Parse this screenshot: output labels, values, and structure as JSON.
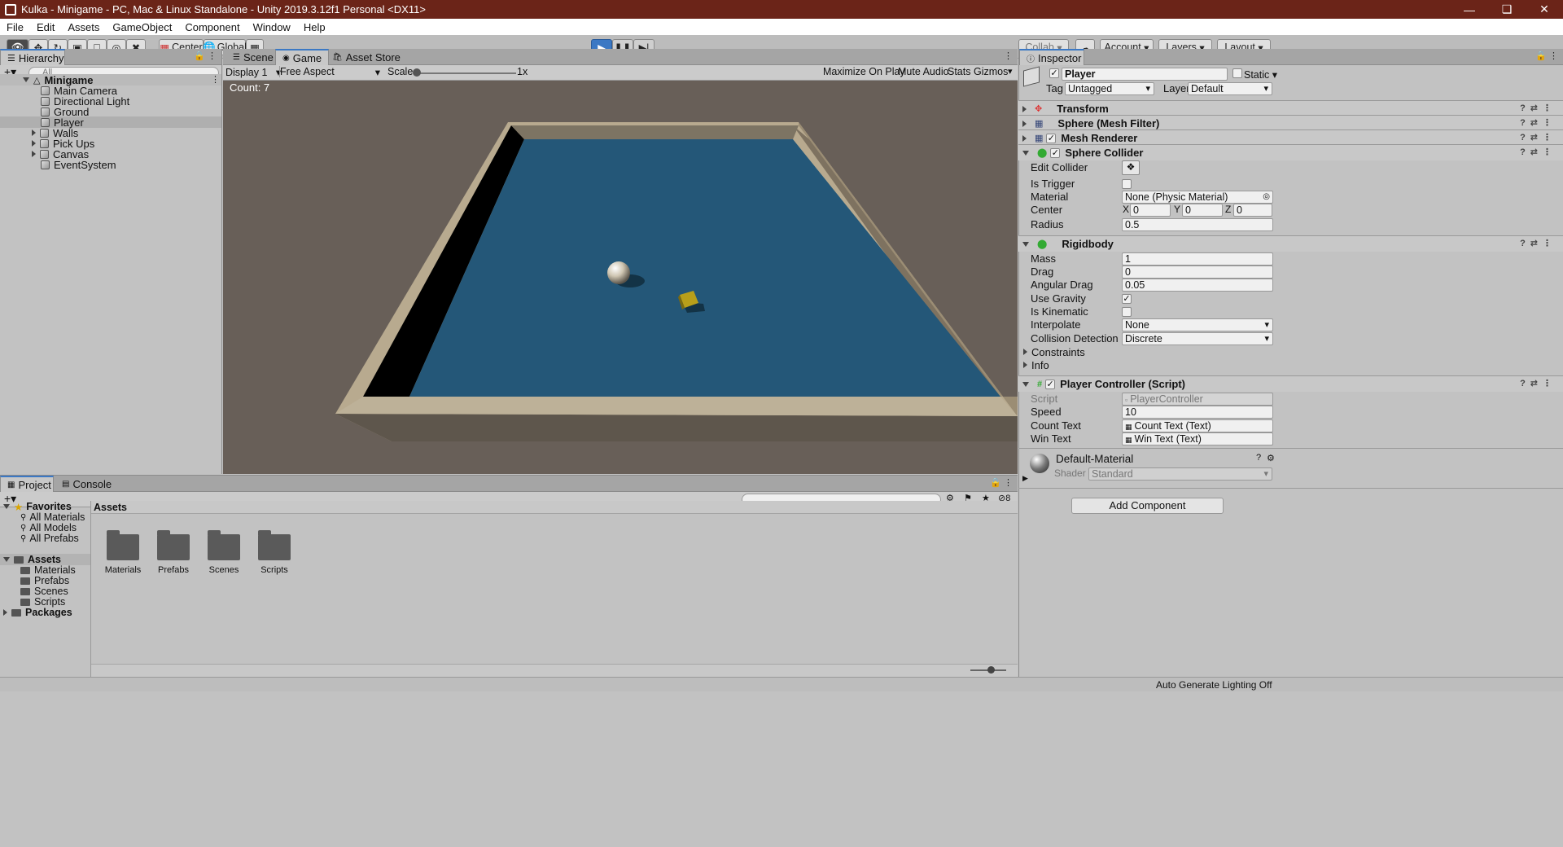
{
  "window": {
    "title": "Kulka - Minigame - PC, Mac & Linux Standalone - Unity 2019.3.12f1 Personal <DX11>"
  },
  "menu": [
    "File",
    "Edit",
    "Assets",
    "GameObject",
    "Component",
    "Window",
    "Help"
  ],
  "toolbar": {
    "center_label": "Center",
    "global_label": "Global",
    "collab_label": "Collab",
    "account_label": "Account",
    "layers_label": "Layers",
    "layout_label": "Layout"
  },
  "hierarchy": {
    "tab": "Hierarchy",
    "search_placeholder": "All",
    "scene": "Minigame",
    "items": [
      "Main Camera",
      "Directional Light",
      "Ground",
      "Player",
      "Walls",
      "Pick Ups",
      "Canvas",
      "EventSystem"
    ]
  },
  "game": {
    "tabs": [
      "Scene",
      "Game",
      "Asset Store"
    ],
    "display": "Display 1",
    "aspect": "Free Aspect",
    "scale_label": "Scale",
    "scale_value": "1x",
    "buttons": [
      "Maximize On Play",
      "Mute Audio",
      "Stats",
      "Gizmos"
    ],
    "count_text": "Count: 7"
  },
  "inspector": {
    "tab": "Inspector",
    "object_name": "Player",
    "static_label": "Static",
    "tag_label": "Tag",
    "tag_value": "Untagged",
    "layer_label": "Layer",
    "layer_value": "Default",
    "components": {
      "transform": "Transform",
      "mesh_filter": "Sphere (Mesh Filter)",
      "mesh_renderer": "Mesh Renderer",
      "sphere_collider": "Sphere Collider",
      "rigidbody": "Rigidbody",
      "player_controller": "Player Controller (Script)"
    },
    "collider": {
      "edit_collider": "Edit Collider",
      "is_trigger": "Is Trigger",
      "material_label": "Material",
      "material_value": "None (Physic Material)",
      "center_label": "Center",
      "cx": "0",
      "cy": "0",
      "cz": "0",
      "radius_label": "Radius",
      "radius_value": "0.5"
    },
    "rigidbody": {
      "mass_label": "Mass",
      "mass": "1",
      "drag_label": "Drag",
      "drag": "0",
      "angular_label": "Angular Drag",
      "angular": "0.05",
      "gravity_label": "Use Gravity",
      "kinematic_label": "Is Kinematic",
      "interpolate_label": "Interpolate",
      "interpolate": "None",
      "collision_label": "Collision Detection",
      "collision": "Discrete",
      "constraints": "Constraints",
      "info": "Info"
    },
    "script": {
      "script_label": "Script",
      "script_value": "PlayerController",
      "speed_label": "Speed",
      "speed": "10",
      "count_label": "Count Text",
      "count_value": "Count Text (Text)",
      "win_label": "Win Text",
      "win_value": "Win Text (Text)"
    },
    "material": {
      "name": "Default-Material",
      "shader_label": "Shader",
      "shader_value": "Standard"
    },
    "add_component": "Add Component"
  },
  "project": {
    "tabs": [
      "Project",
      "Console"
    ],
    "favorites": "Favorites",
    "fav_items": [
      "All Materials",
      "All Models",
      "All Prefabs"
    ],
    "assets": "Assets",
    "asset_folders": [
      "Materials",
      "Prefabs",
      "Scenes",
      "Scripts"
    ],
    "packages": "Packages",
    "breadcrumb": "Assets",
    "hidden_count": "8"
  },
  "status": {
    "text": "Auto Generate Lighting Off"
  }
}
